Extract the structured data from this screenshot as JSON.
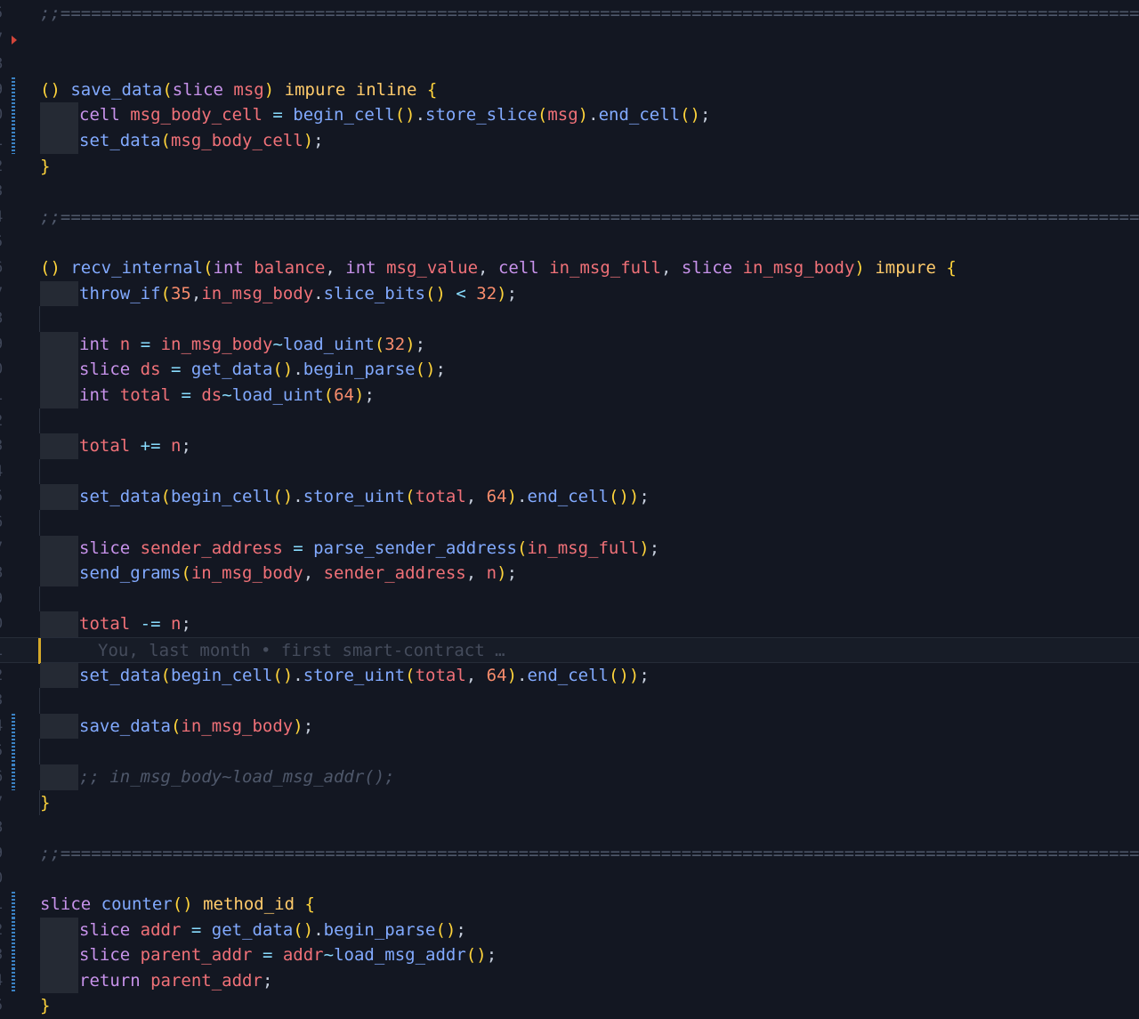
{
  "editor": {
    "lines": [
      {
        "num": "5",
        "text": ";;============================================================================================================"
      },
      {
        "num": "7",
        "text": ""
      },
      {
        "num": "8",
        "text": ""
      },
      {
        "num": "9",
        "text": "() save_data(slice msg) impure inline {"
      },
      {
        "num": "0",
        "text": "cell msg_body_cell = begin_cell().store_slice(msg).end_cell();"
      },
      {
        "num": "1",
        "text": "set_data(msg_body_cell);"
      },
      {
        "num": "2",
        "text": "}"
      },
      {
        "num": "3",
        "text": ""
      },
      {
        "num": "4",
        "text": ";;============================================================================================================"
      },
      {
        "num": "5",
        "text": ""
      },
      {
        "num": "6",
        "text": "() recv_internal(int balance, int msg_value, cell in_msg_full, slice in_msg_body) impure {"
      },
      {
        "num": "7",
        "text": "throw_if(35,in_msg_body.slice_bits() < 32);"
      },
      {
        "num": "8",
        "text": ""
      },
      {
        "num": "9",
        "text": "int n = in_msg_body~load_uint(32);"
      },
      {
        "num": "0",
        "text": "slice ds = get_data().begin_parse();"
      },
      {
        "num": "1",
        "text": "int total = ds~load_uint(64);"
      },
      {
        "num": "2",
        "text": ""
      },
      {
        "num": "3",
        "text": "total += n;"
      },
      {
        "num": "4",
        "text": ""
      },
      {
        "num": "5",
        "text": "set_data(begin_cell().store_uint(total, 64).end_cell());"
      },
      {
        "num": "6",
        "text": ""
      },
      {
        "num": "7",
        "text": "slice sender_address = parse_sender_address(in_msg_full);"
      },
      {
        "num": "8",
        "text": "send_grams(in_msg_body, sender_address, n);"
      },
      {
        "num": "9",
        "text": ""
      },
      {
        "num": "0",
        "text": "total -= n;"
      },
      {
        "num": "1",
        "text": ""
      },
      {
        "num": "2",
        "text": "set_data(begin_cell().store_uint(total, 64).end_cell());"
      },
      {
        "num": "3",
        "text": ""
      },
      {
        "num": "4",
        "text": "save_data(in_msg_body);"
      },
      {
        "num": "5",
        "text": ""
      },
      {
        "num": "6",
        "text": ";; in_msg_body~load_msg_addr();"
      },
      {
        "num": "7",
        "text": "}"
      },
      {
        "num": "8",
        "text": ""
      },
      {
        "num": "9",
        "text": ";;============================================================================================================"
      },
      {
        "num": "0",
        "text": ""
      },
      {
        "num": "1",
        "text": "slice counter() method_id {"
      },
      {
        "num": "2",
        "text": "slice addr = get_data().begin_parse();"
      },
      {
        "num": "3",
        "text": "slice parent_addr = addr~load_msg_addr();"
      },
      {
        "num": "4",
        "text": "return parent_addr;"
      },
      {
        "num": "5",
        "text": "}"
      }
    ],
    "blame": "You, last month • first smart-contract …"
  },
  "colors": {
    "background": "#131722",
    "keyword": "#c792ea",
    "function": "#82aaff",
    "variable": "#f07178",
    "number": "#f78c6c",
    "comment": "#4f586b",
    "git_added": "#3b82c4"
  }
}
